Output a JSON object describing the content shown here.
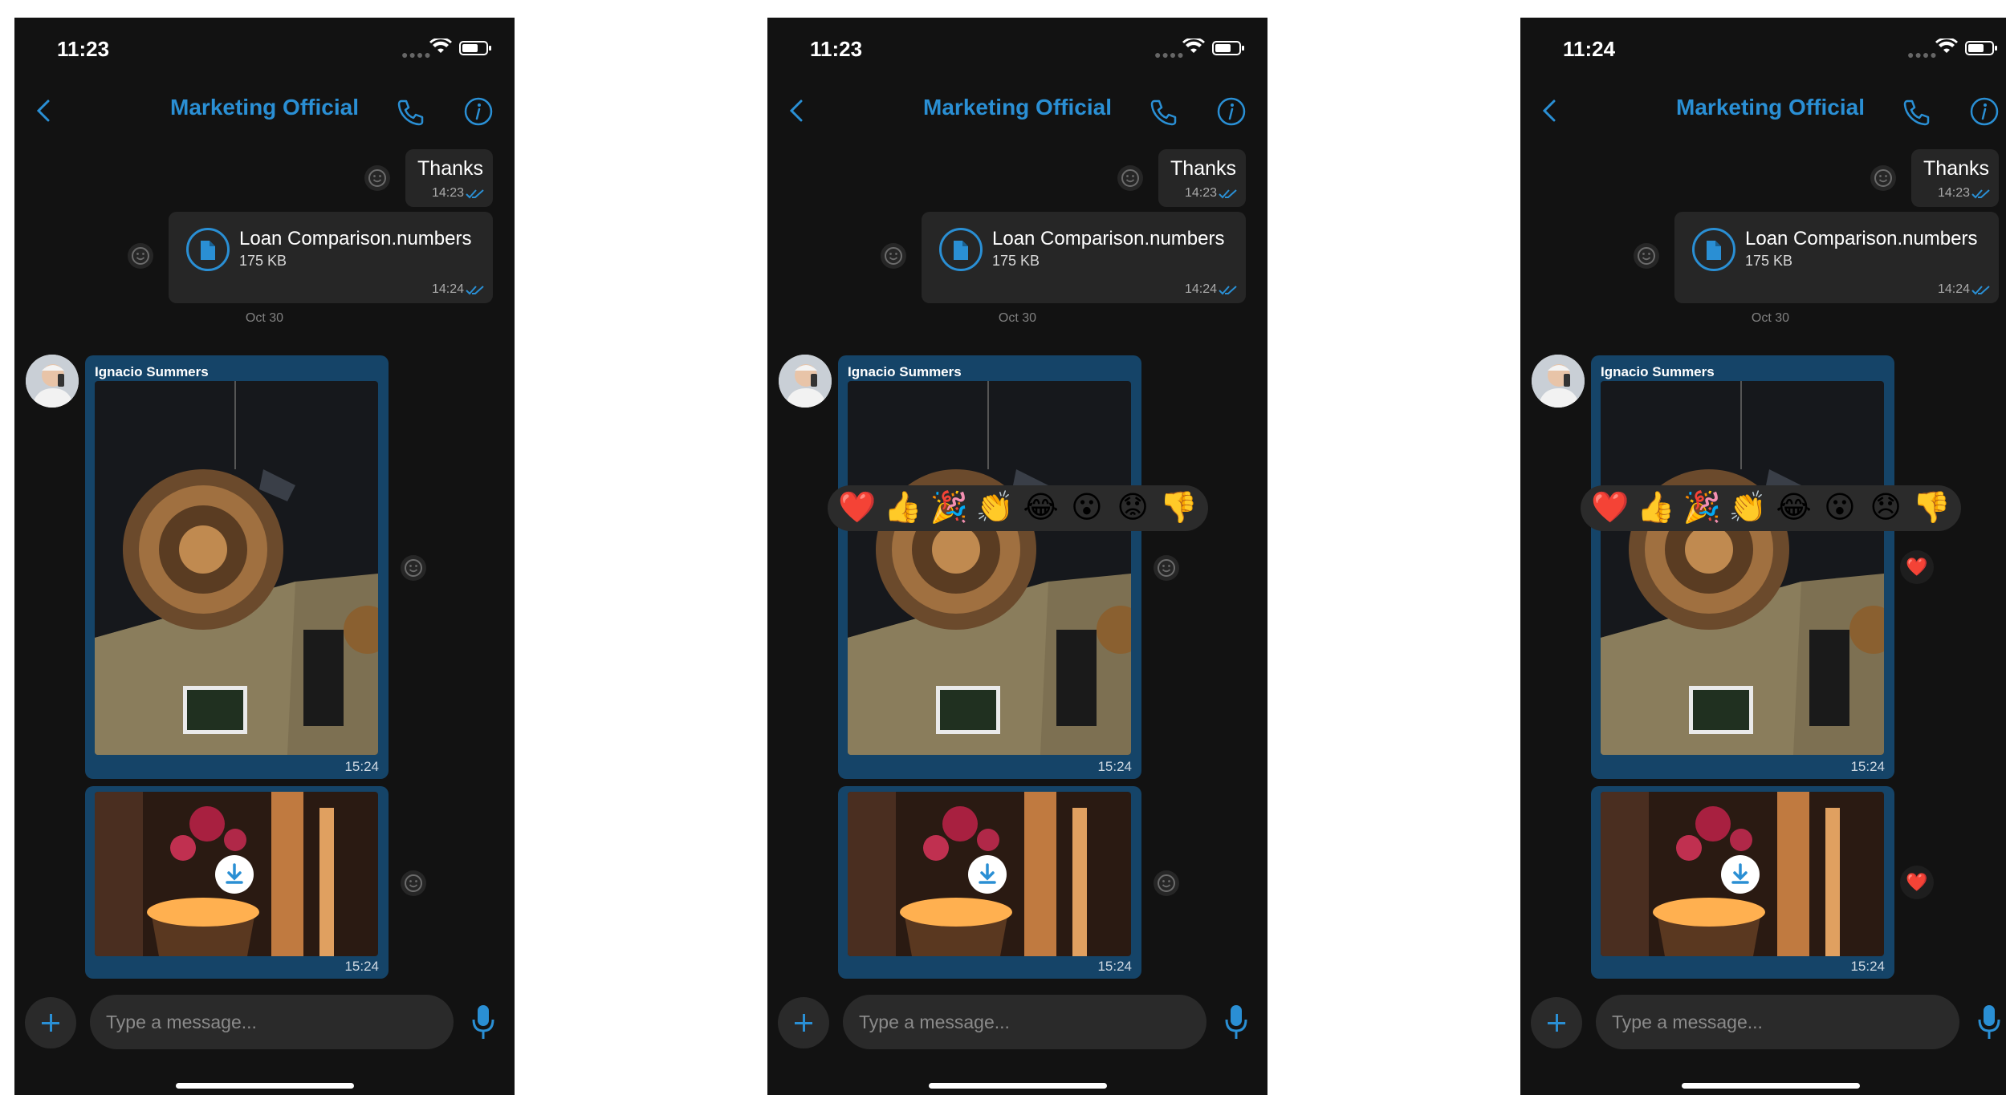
{
  "screens": [
    {
      "status": {
        "time": "11:23"
      },
      "header": {
        "title": "Marketing Official"
      },
      "messages": {
        "thanks": {
          "text": "Thanks",
          "time": "14:23"
        },
        "file": {
          "name": "Loan Comparison.numbers",
          "size": "175 KB",
          "time": "14:24"
        },
        "date_separator": "Oct 30",
        "sender": "Ignacio Summers",
        "image1_time": "15:24",
        "image2_time": "15:24"
      },
      "composer": {
        "placeholder": "Type a message..."
      }
    },
    {
      "status": {
        "time": "11:23"
      },
      "header": {
        "title": "Marketing Official"
      },
      "messages": {
        "thanks": {
          "text": "Thanks",
          "time": "14:23"
        },
        "file": {
          "name": "Loan Comparison.numbers",
          "size": "175 KB",
          "time": "14:24"
        },
        "date_separator": "Oct 30",
        "sender": "Ignacio Summers",
        "image1_time": "15:24",
        "image2_time": "15:24"
      },
      "reactions": [
        "❤️",
        "👍",
        "🎉",
        "👏",
        "😂",
        "😮",
        "😟",
        "👎"
      ],
      "composer": {
        "placeholder": "Type a message..."
      }
    },
    {
      "status": {
        "time": "11:24"
      },
      "header": {
        "title": "Marketing Official"
      },
      "messages": {
        "thanks": {
          "text": "Thanks",
          "time": "14:23"
        },
        "file": {
          "name": "Loan Comparison.numbers",
          "size": "175 KB",
          "time": "14:24"
        },
        "date_separator": "Oct 30",
        "sender": "Ignacio Summers",
        "image1_time": "15:24",
        "image2_time": "15:24",
        "image_reactions": [
          "❤️",
          "❤️"
        ]
      },
      "reactions": [
        "❤️",
        "👍",
        "🎉",
        "👏",
        "😂",
        "😮",
        "😞",
        "👎"
      ],
      "composer": {
        "placeholder": "Type a message..."
      }
    }
  ],
  "colors": {
    "accent": "#2a8fd4",
    "background": "#121212",
    "incoming_bubble": "#154468",
    "outgoing_bubble": "#262626"
  }
}
